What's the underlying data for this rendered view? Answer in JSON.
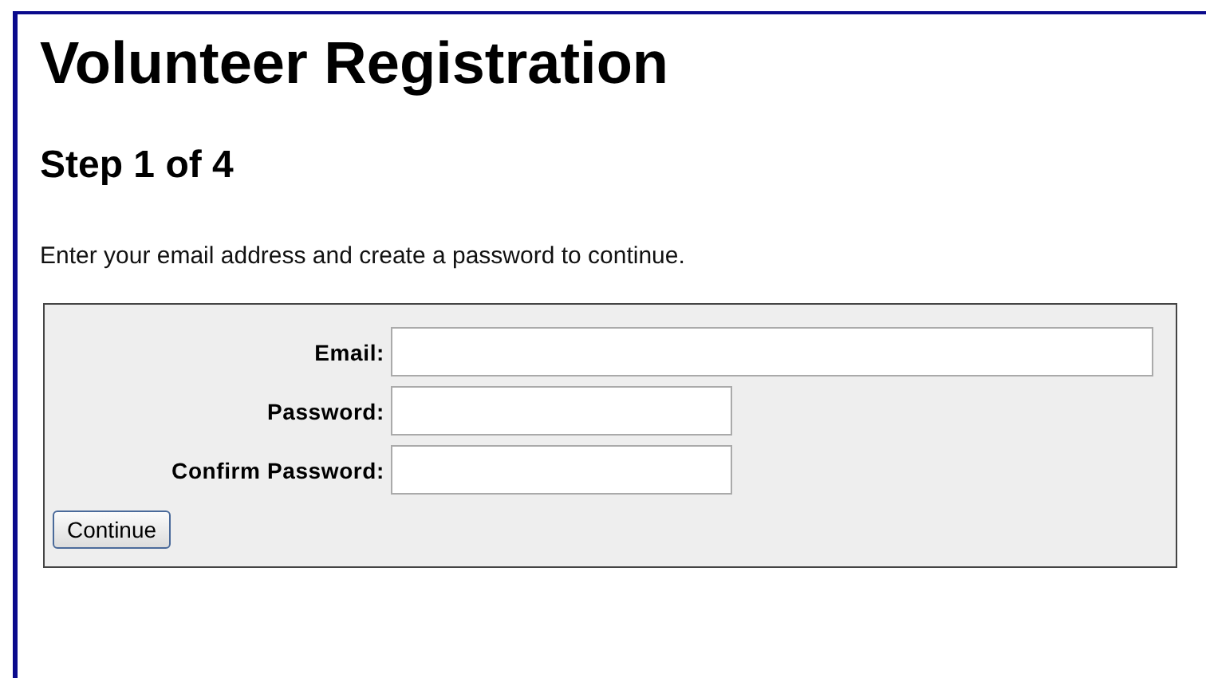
{
  "title": "Volunteer Registration",
  "step": "Step 1 of 4",
  "intro": "Enter your email address and create a password to continue.",
  "form": {
    "fields": [
      {
        "label": "Email:",
        "kind": "wide"
      },
      {
        "label": "Password:",
        "kind": "short"
      },
      {
        "label": "Confirm Password:",
        "kind": "short"
      }
    ],
    "button": "Continue"
  }
}
